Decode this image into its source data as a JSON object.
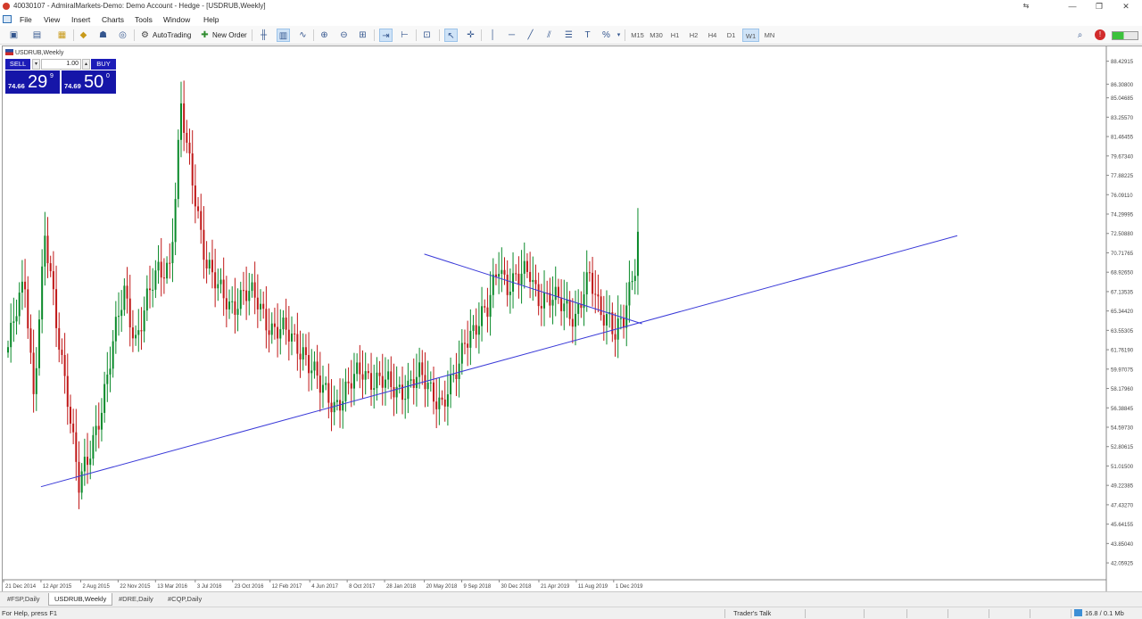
{
  "window": {
    "title": "40030107 - AdmiralMarkets-Demo: Demo Account - Hedge - [USDRUB,Weekly]",
    "controls": [
      "—",
      "❐",
      "✕"
    ]
  },
  "menu": {
    "items": [
      "File",
      "View",
      "Insert",
      "Charts",
      "Tools",
      "Window",
      "Help"
    ]
  },
  "toolbar": {
    "auto_trading": "AutoTrading",
    "new_order": "New Order",
    "timeframes": [
      "M15",
      "M30",
      "H1",
      "H2",
      "H4",
      "D1",
      "W1",
      "MN"
    ],
    "active_timeframe": "W1"
  },
  "chart": {
    "symbol_label": "USDRUB,Weekly",
    "one_click": {
      "sell_label": "SELL",
      "buy_label": "BUY",
      "lot": "1.00",
      "bid_prefix": "74.66",
      "bid_big": "29",
      "bid_point": "9",
      "ask_prefix": "74.69",
      "ask_big": "50",
      "ask_point": "0"
    },
    "colors": {
      "bull_candle": "#0a8a2a",
      "bear_candle": "#c01818",
      "trendline": "#3a3ad8"
    }
  },
  "chart_data": {
    "type": "candlestick",
    "symbol": "USDRUB",
    "timeframe": "Weekly",
    "price_axis_labels": [
      "88.42915",
      "86.30800",
      "85.04685",
      "83.25570",
      "81.46455",
      "79.67340",
      "77.88225",
      "76.09110",
      "74.29995",
      "72.50880",
      "70.71765",
      "68.92650",
      "67.13535",
      "65.34420",
      "63.55305",
      "61.76190",
      "59.97075",
      "58.17960",
      "56.38845",
      "54.59730",
      "52.80615",
      "51.01500",
      "49.22385",
      "47.43270",
      "45.64155",
      "43.85040",
      "42.05925"
    ],
    "time_axis_labels": [
      "21 Dec 2014",
      "12 Apr 2015",
      "2 Aug 2015",
      "22 Nov 2015",
      "13 Mar 2016",
      "3 Jul 2016",
      "23 Oct 2016",
      "12 Feb 2017",
      "4 Jun 2017",
      "8 Oct 2017",
      "28 Jan 2018",
      "20 May 2018",
      "9 Sep 2018",
      "30 Dec 2018",
      "21 Apr 2019",
      "11 Aug 2019",
      "1 Dec 2019"
    ],
    "ylim": [
      40.5,
      89.8
    ],
    "anchors": [
      [
        0,
        62
      ],
      [
        6,
        68
      ],
      [
        9,
        58
      ],
      [
        13,
        72
      ],
      [
        17,
        64
      ],
      [
        21,
        58
      ],
      [
        25,
        49
      ],
      [
        28,
        51
      ],
      [
        33,
        57
      ],
      [
        37,
        62
      ],
      [
        41,
        67
      ],
      [
        45,
        63
      ],
      [
        49,
        66
      ],
      [
        53,
        69
      ],
      [
        57,
        70
      ],
      [
        59,
        76
      ],
      [
        61,
        84
      ],
      [
        63,
        80
      ],
      [
        66,
        76
      ],
      [
        70,
        70
      ],
      [
        74,
        67
      ],
      [
        78,
        66
      ],
      [
        83,
        67
      ],
      [
        88,
        66
      ],
      [
        93,
        64
      ],
      [
        98,
        63
      ],
      [
        104,
        62
      ],
      [
        110,
        58
      ],
      [
        115,
        57
      ],
      [
        120,
        58
      ],
      [
        125,
        60
      ],
      [
        130,
        59
      ],
      [
        135,
        58
      ],
      [
        140,
        58.5
      ],
      [
        145,
        59
      ],
      [
        150,
        58
      ],
      [
        153,
        57
      ],
      [
        156,
        58
      ],
      [
        159,
        60
      ],
      [
        161,
        63
      ],
      [
        164,
        64
      ],
      [
        169,
        65
      ],
      [
        173,
        70
      ],
      [
        176,
        68
      ],
      [
        180,
        68
      ],
      [
        184,
        69
      ],
      [
        187,
        67
      ],
      [
        192,
        66
      ],
      [
        197,
        66
      ],
      [
        200,
        65
      ],
      [
        205,
        68
      ],
      [
        208,
        66
      ],
      [
        212,
        65
      ],
      [
        214,
        63
      ],
      [
        217,
        64
      ],
      [
        221,
        70
      ],
      [
        222,
        73
      ]
    ],
    "trendlines": [
      {
        "from": [
          "12 Apr 2015",
          49.1
        ],
        "to": [
          "1 Dec 2019",
          63.6
        ]
      },
      {
        "from": [
          "20 May 2018",
          70.6
        ],
        "to": [
          "1 Dec 2019",
          65.0
        ]
      }
    ]
  },
  "bottom_tabs": {
    "items": [
      "#FSP,Daily",
      "USDRUB,Weekly",
      "#DRE,Daily",
      "#CQP,Daily"
    ],
    "active": "USDRUB,Weekly"
  },
  "status": {
    "help": "For Help, press F1",
    "traders_talk": "Trader's Talk",
    "connection": "16.8 / 0.1 Mb"
  }
}
